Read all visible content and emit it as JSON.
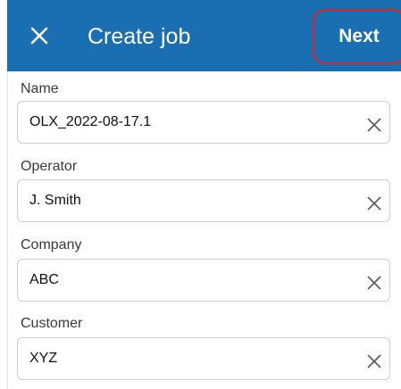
{
  "header": {
    "close_icon": "close-icon",
    "title": "Create job",
    "next_label": "Next",
    "background_color": "#1a6fb3",
    "highlight_color": "#d8242a"
  },
  "fields": [
    {
      "label": "Name",
      "value": "OLX_2022-08-17.1",
      "clear_icon": "clear-icon"
    },
    {
      "label": "Operator",
      "value": "J. Smith",
      "clear_icon": "clear-icon"
    },
    {
      "label": "Company",
      "value": "ABC",
      "clear_icon": "clear-icon"
    },
    {
      "label": "Customer",
      "value": "XYZ",
      "clear_icon": "clear-icon"
    }
  ]
}
